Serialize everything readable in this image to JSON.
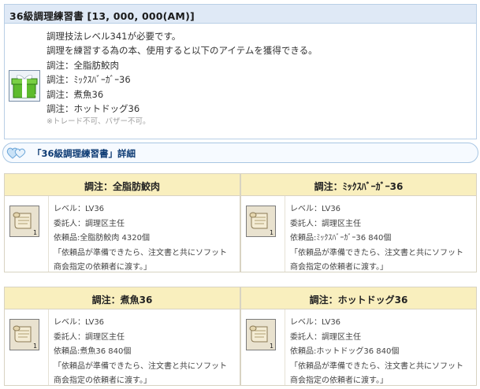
{
  "item": {
    "title": "36級調理練習書 [13, 000, 000(AM)]",
    "icon": "green-gift-box-icon",
    "icon_count": "1",
    "lines": [
      "調理技法レベル341が必要です。",
      "調理を練習する為の本、使用すると以下のアイテムを獲得できる。",
      "調注：全脂肪鮫肉",
      "調注：ﾐｯｸｽﾊﾞｰｶﾞｰ36",
      "調注：煮魚36",
      "調注：ホットドッグ36"
    ],
    "note": "※トレード不可、バザー不可。"
  },
  "section": {
    "title": "「36級調理練習書」詳細",
    "icon": "double-heart-icon"
  },
  "cards": [
    {
      "title": "調注：全脂肪鮫肉",
      "icon": "scroll-icon",
      "icon_count": "1",
      "level": "レベル：LV36",
      "client": "委託人：調理区主任",
      "request": "依頼品:全脂肪鮫肉 4320個",
      "message_1": "「依頼品が準備できたら、注文書と共にソフット",
      "message_2": "商会指定の依頼者に渡す。」"
    },
    {
      "title": "調注：ﾐｯｸｽﾊﾞｰｶﾞｰ36",
      "icon": "scroll-icon",
      "icon_count": "1",
      "level": "レベル：LV36",
      "client": "委託人：調理区主任",
      "request": "依頼品:ﾐｯｸｽﾊﾞｰｶﾞｰ36 840個",
      "message_1": "「依頼品が準備できたら、注文書と共にソフット",
      "message_2": "商会指定の依頼者に渡す。」"
    },
    {
      "title": "調注：煮魚36",
      "icon": "scroll-icon",
      "icon_count": "1",
      "level": "レベル：LV36",
      "client": "委託人：調理区主任",
      "request": "依頼品:煮魚36 840個",
      "message_1": "「依頼品が準備できたら、注文書と共にソフット",
      "message_2": "商会指定の依頼者に渡す。」"
    },
    {
      "title": "調注：ホットドッグ36",
      "icon": "scroll-icon",
      "icon_count": "1",
      "level": "レベル：LV36",
      "client": "委託人：調理区主任",
      "request": "依頼品:ホットドッグ36 840個",
      "message_1": "「依頼品が準備できたら、注文書と共にソフット",
      "message_2": "商会指定の依頼者に渡す。」"
    }
  ]
}
